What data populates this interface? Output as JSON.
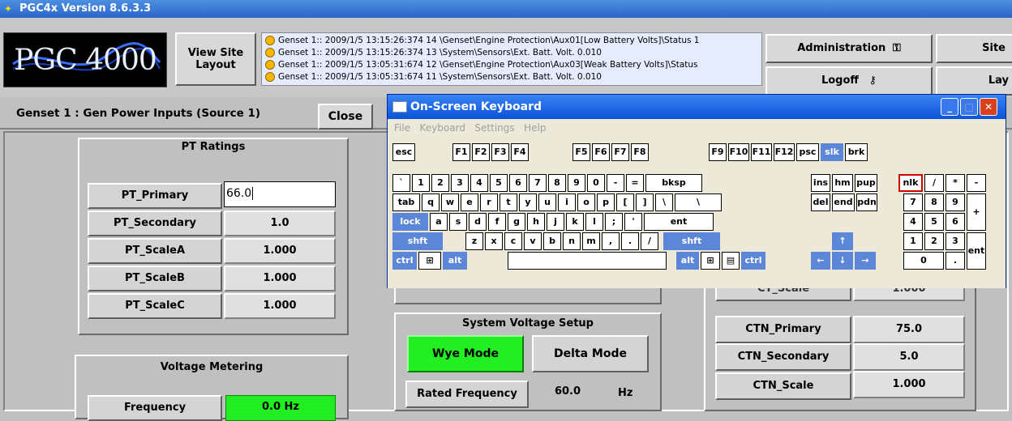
{
  "app": {
    "title": "PGC4x Version 8.6.3.3",
    "icon": "app-icon"
  },
  "header": {
    "logo_text": "PGC 4000",
    "view_site_label_1": "View Site",
    "view_site_label_2": "Layout",
    "events": [
      "Genset 1:: 2009/1/5 13:15:26:374 14 \\Genset\\Engine Protection\\Aux01[Low Battery Volts]\\Status 1",
      "Genset 1:: 2009/1/5 13:15:26:374 13 \\System\\Sensors\\Ext. Batt. Volt. 0.010",
      "Genset 1:: 2009/1/5 13:05:31:674 12 \\Genset\\Engine Protection\\Aux03[Weak Battery Volts]\\Status",
      "Genset 1:: 2009/1/5 13:05:31:674 11 \\System\\Sensors\\Ext. Batt. Volt. 0.010"
    ],
    "admin_label": "Administration",
    "site_label": "Site",
    "logoff_label": "Logoff",
    "lay_label": "Lay"
  },
  "page": {
    "title": "Genset 1 : Gen Power Inputs (Source 1)",
    "close_label": "Close"
  },
  "pt": {
    "title": "PT Ratings",
    "rows": [
      {
        "label": "PT_Primary",
        "value": "66.0"
      },
      {
        "label": "PT_Secondary",
        "value": "1.0"
      },
      {
        "label": "PT_ScaleA",
        "value": "1.000"
      },
      {
        "label": "PT_ScaleB",
        "value": "1.000"
      },
      {
        "label": "PT_ScaleC",
        "value": "1.000"
      }
    ]
  },
  "voltage_metering": {
    "title": "Voltage Metering",
    "frequency_label": "Frequency",
    "frequency_value": "0.0 Hz"
  },
  "system_voltage": {
    "title": "System Voltage Setup",
    "wye_label": "Wye Mode",
    "delta_label": "Delta Mode",
    "rated_freq_label": "Rated Frequency",
    "rated_freq_value": "60.0",
    "rated_freq_unit": "Hz"
  },
  "ct": {
    "partial_label": "CT_Scale",
    "partial_value": "1.000",
    "rows": [
      {
        "label": "CTN_Primary",
        "value": "75.0"
      },
      {
        "label": "CTN_Secondary",
        "value": "5.0"
      },
      {
        "label": "CTN_Scale",
        "value": "1.000"
      }
    ]
  },
  "osk": {
    "title": "On-Screen Keyboard",
    "menu": [
      "File",
      "Keyboard",
      "Settings",
      "Help"
    ]
  },
  "colors": {
    "green": "#22ee22",
    "titlebar": "#2a66c8",
    "osk_blue": "#0a4fd1"
  }
}
